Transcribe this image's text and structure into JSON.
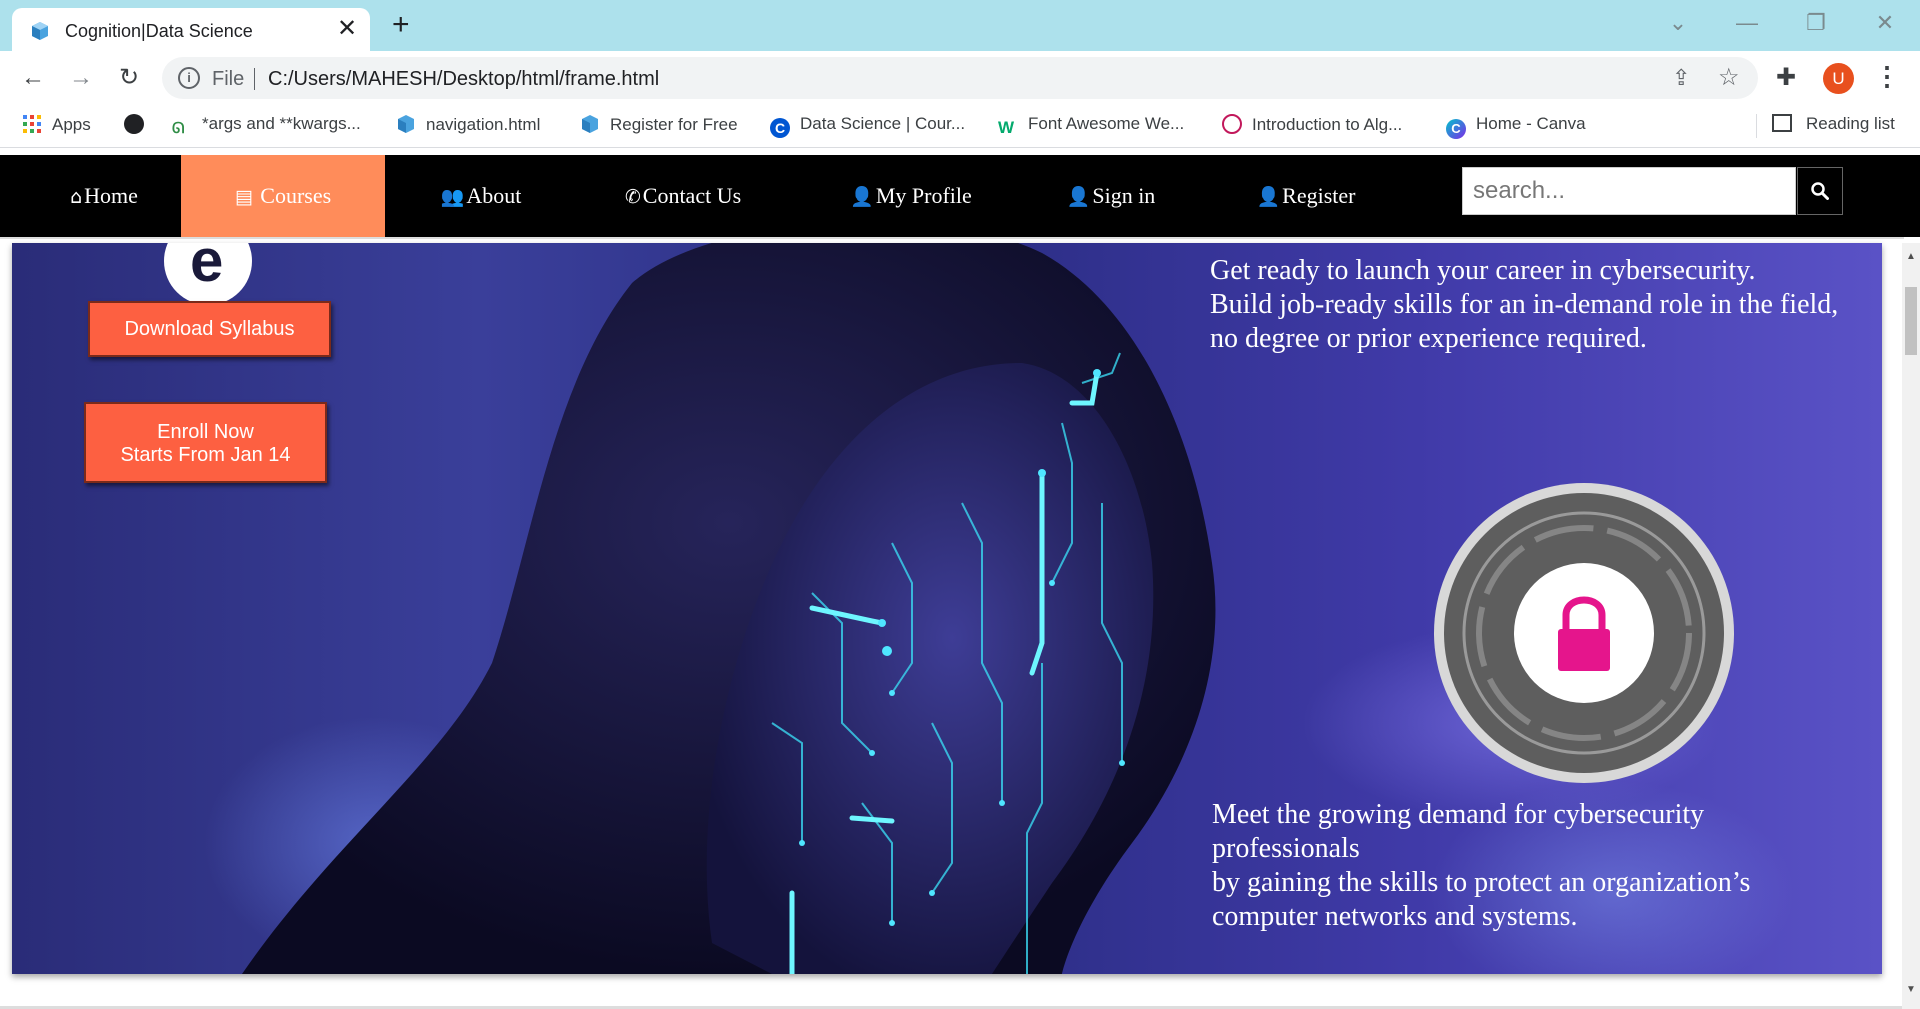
{
  "browser": {
    "tab": {
      "title": "Cognition|Data Science",
      "close": "✕"
    },
    "new_tab": "+",
    "window_controls": {
      "dropdown": "⌄",
      "minimize": "—",
      "restore": "❐",
      "close": "✕"
    },
    "url_prefix": "File",
    "url": "C:/Users/MAHESH/Desktop/html/frame.html",
    "avatar_letter": "U",
    "bookmarks": [
      {
        "label": "Apps",
        "icon": "apps-grid-icon"
      },
      {
        "label": "",
        "icon": "globe-icon"
      },
      {
        "label": "*args and **kwargs...",
        "icon": "geeksforgeeks-icon"
      },
      {
        "label": "navigation.html",
        "icon": "file-icon"
      },
      {
        "label": "Register for Free",
        "icon": "file-icon"
      },
      {
        "label": "Data Science | Cour...",
        "icon": "coursera-icon"
      },
      {
        "label": "Font Awesome We...",
        "icon": "w3schools-icon"
      },
      {
        "label": "Introduction to Alg...",
        "icon": "course-icon"
      },
      {
        "label": "Home - Canva",
        "icon": "canva-icon"
      }
    ],
    "reading_list": "Reading list"
  },
  "site": {
    "nav": [
      {
        "label": "Home",
        "icon": "home-icon",
        "glyph": "⌂"
      },
      {
        "label": " Courses",
        "icon": "book-icon",
        "glyph": "▤"
      },
      {
        "label": "About",
        "icon": "users-icon",
        "glyph": "👥"
      },
      {
        "label": "Contact Us",
        "icon": "phone-icon",
        "glyph": "✆"
      },
      {
        "label": "My Profile",
        "icon": "user-icon",
        "glyph": "👤"
      },
      {
        "label": "Sign in",
        "icon": "user-plus-icon",
        "glyph": "👤"
      },
      {
        "label": "Register",
        "icon": "user-icon",
        "glyph": "👤"
      }
    ],
    "active_nav": "Courses",
    "search_placeholder": "search...",
    "accent": "#ff8c5a",
    "button_color": "#fd6041"
  },
  "hero": {
    "download_button": "Download Syllabus",
    "enroll_line1": "Enroll Now",
    "enroll_line2": "Starts From Jan 14",
    "text_top": [
      "Get ready to launch your career in cybersecurity.",
      "Build job-ready skills for an in-demand role in the field,",
      "no degree or prior experience required."
    ],
    "text_bottom": [
      "Meet the growing demand for cybersecurity",
      "professionals",
      "by gaining the skills to protect an organization’s",
      "computer networks and systems."
    ]
  }
}
